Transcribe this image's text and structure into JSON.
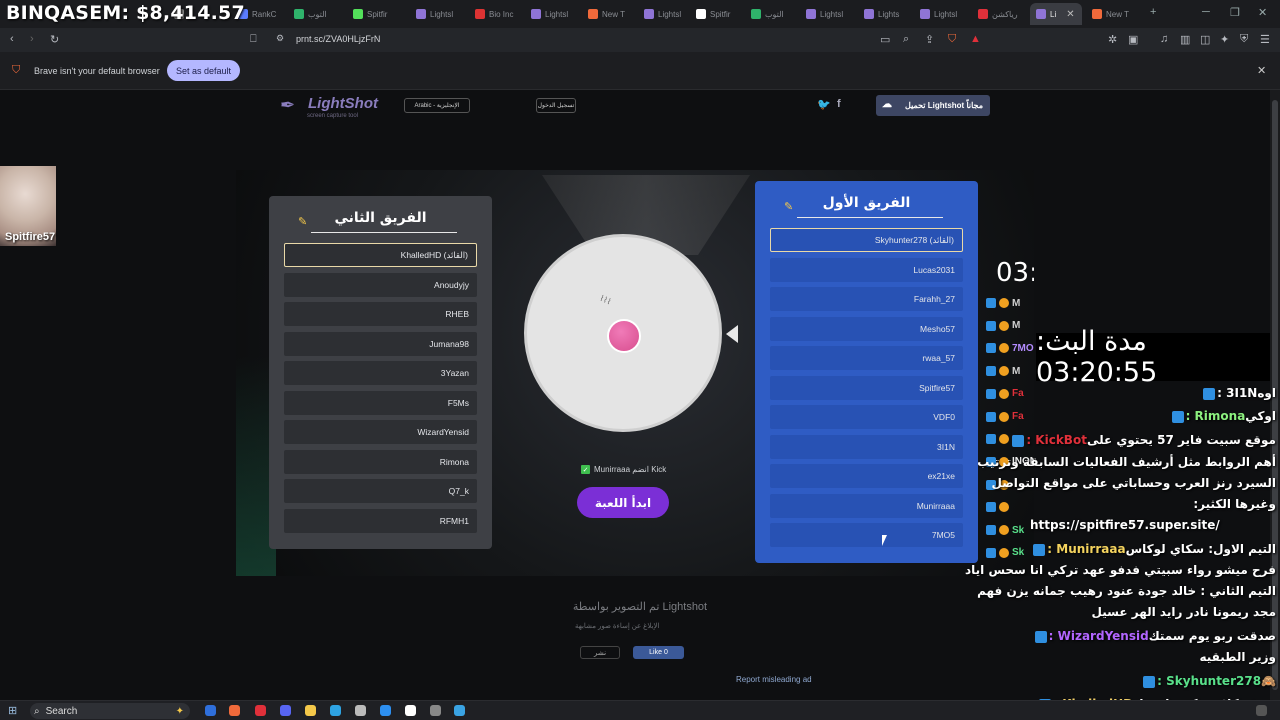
{
  "overlay": {
    "binq": "BINQASEM: $8,414.57",
    "cam_name": "Spitfire57",
    "timer_partial": "03:",
    "uptime": "مدة البث: 03:20:55"
  },
  "tabs": [
    {
      "label": "",
      "color": "#888"
    },
    {
      "label": "RankC",
      "color": "#5b7cff"
    },
    {
      "label": "التوب",
      "color": "#2fb36b"
    },
    {
      "label": "Spitfir",
      "color": "#53e05a"
    },
    {
      "label": "Lightsl",
      "color": "#8f74d6"
    },
    {
      "label": "Bio Inc",
      "color": "#d33"
    },
    {
      "label": "Lightsl",
      "color": "#8f74d6"
    },
    {
      "label": "New T",
      "color": "#f06a3b"
    },
    {
      "label": "Lightsl",
      "color": "#8f74d6"
    },
    {
      "label": "Spitfir",
      "color": "#fff"
    },
    {
      "label": "التوب",
      "color": "#2fb36b"
    },
    {
      "label": "Lightsl",
      "color": "#8f74d6"
    },
    {
      "label": "Lights",
      "color": "#8f74d6"
    },
    {
      "label": "Lightsl",
      "color": "#8f74d6"
    },
    {
      "label": "رياكشن",
      "color": "#e0303a"
    },
    {
      "label": "Li",
      "color": "#8f74d6"
    },
    {
      "label": "New T",
      "color": "#f06a3b"
    }
  ],
  "browser": {
    "url": "prnt.sc/ZVA0HLjzFrN",
    "infobar_message": "Brave isn't your default browser",
    "infobar_button": "Set as default"
  },
  "lightshot": {
    "logo": "LightShot",
    "logo_sub": "screen capture tool",
    "language": "Arabic - الإنجليزية",
    "login": "تسجيل الدخول",
    "download": "تحميل Lightshot مجاناً",
    "caption": "تم التصوير بواسطة Lightshot",
    "links": "الإبلاغ عن إساءة   صور مشابهة",
    "share": "نشر",
    "like": "Like 0",
    "report": "Report misleading ad"
  },
  "game": {
    "team2": {
      "title": "الفريق الثاني",
      "players": [
        "KhalledHD (القائد)",
        "Anoudyjy",
        "RHEB",
        "Jumana98",
        "3Yazan",
        "F5Ms",
        "WizardYensid",
        "Rimona",
        "Q7_k",
        "RFMH1"
      ]
    },
    "team1": {
      "title": "الفريق الأول",
      "players": [
        "Skyhunter278 (القائد)",
        "Lucas2031",
        "Farahh_27",
        "Mesho57",
        "rwaa_57",
        "Spitfire57",
        "VDF0",
        "3I1N",
        "ex21xe",
        "Munirraaa",
        "7MO5"
      ]
    },
    "kick_label": "Munirraaa انضم Kick",
    "start_button": "ابدأ اللعبة"
  },
  "chat": {
    "partial_names": [
      {
        "text": "M",
        "color": "#cfcfcf"
      },
      {
        "text": "M",
        "color": "#cfcfcf"
      },
      {
        "text": "7MO5",
        "color": "#b48cff"
      },
      {
        "text": "M",
        "color": "#cfcfcf"
      },
      {
        "text": "Fa",
        "color": "#e0303a"
      },
      {
        "text": "Fa",
        "color": "#e0303a"
      },
      {
        "text": "Fa",
        "color": "#e0303a"
      },
      {
        "text": "INONA4",
        "color": "#eee"
      },
      {
        "text": "",
        "color": "#cfcfcf"
      },
      {
        "text": "",
        "color": "#cfcfcf"
      },
      {
        "text": "Sk",
        "color": "#59e08a"
      },
      {
        "text": "Sk",
        "color": "#59e08a"
      }
    ],
    "lines": [
      {
        "name": "3I1N",
        "name_color": "#fff",
        "text": "اوه"
      },
      {
        "name": "Rimona",
        "name_color": "#8cf07f",
        "text": "اوكي"
      },
      {
        "name": "KickBot",
        "name_color": "#e0303a",
        "text": "موقع سبيت فاير 57 يحتوي على"
      },
      {
        "name": "",
        "name_color": "#fff",
        "text": "أهم الروابط مثل أرشيف الفعاليات السابقة وترتيب"
      },
      {
        "name": "",
        "name_color": "#fff",
        "text": "السيرد رنز العرب وحساباتي على مواقع التواصل"
      },
      {
        "name": "",
        "name_color": "#fff",
        "text": "وغيرها الكثير:"
      },
      {
        "name": "",
        "name_color": "#fff",
        "text": "https://spitfire57.super.site/"
      },
      {
        "name": "Munirraaa",
        "name_color": "#f4d35e",
        "text": "التيم الاول: سكاي لوكاس"
      },
      {
        "name": "",
        "name_color": "#fff",
        "text": "فرح ميشو رواء سبيتي فدفو عهد تركي انا سحس اياد"
      },
      {
        "name": "",
        "name_color": "#fff",
        "text": "التيم الثاني : خالد جودة عنود رهيب جمانه يزن فهم"
      },
      {
        "name": "",
        "name_color": "#fff",
        "text": "مجد ريمونا نادر رايد الهر عسيل"
      },
      {
        "name": "WizardYensid",
        "name_color": "#b266ff",
        "text": "صدقت ربو يوم سمتك"
      },
      {
        "name": "",
        "name_color": "#fff",
        "text": "وزير الطبقيه"
      },
      {
        "name": "Skyhunter278",
        "name_color": "#59e08a",
        "text": "🙈"
      },
      {
        "name": "KhalledHD",
        "name_color": "#f0cf6a",
        "text": "شوف كلام تركي ياضنيل"
      }
    ]
  },
  "taskbar": {
    "search": "Search"
  }
}
